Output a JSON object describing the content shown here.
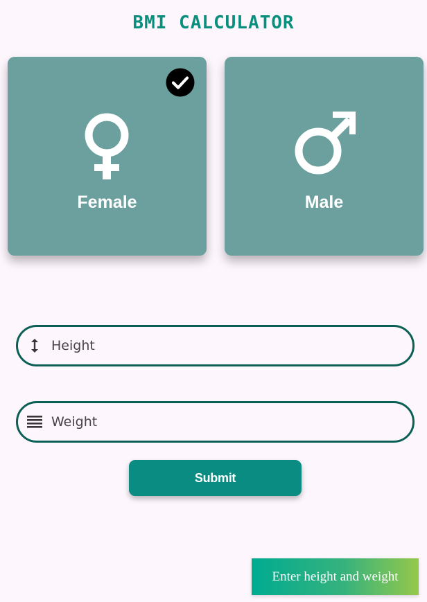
{
  "app": {
    "title": "BMI CALCULATOR"
  },
  "gender": {
    "selected": "female",
    "female": {
      "label": "Female",
      "icon": "female-symbol-icon",
      "selected": true
    },
    "male": {
      "label": "Male",
      "icon": "male-symbol-icon",
      "selected": false
    }
  },
  "form": {
    "height": {
      "placeholder": "Height",
      "value": "",
      "icon": "vertical-arrows-icon"
    },
    "weight": {
      "placeholder": "Weight",
      "value": "",
      "icon": "weight-lines-icon"
    },
    "submit_label": "Submit"
  },
  "toast": {
    "message": "Enter height and weight"
  },
  "colors": {
    "title": "#0a8f7f",
    "card": "#6ba09f",
    "field_border": "#0b5f55",
    "button": "#0a8c83",
    "background": "#fdf7fd"
  }
}
